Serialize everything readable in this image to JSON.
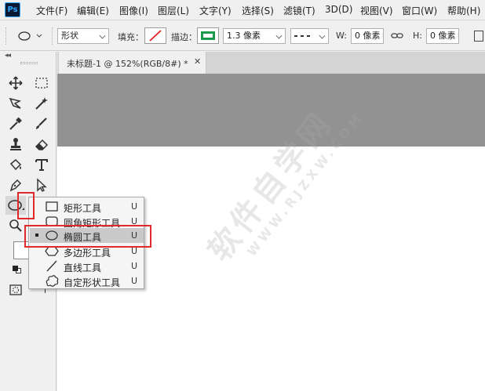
{
  "app": {
    "logo": "Ps"
  },
  "menu": [
    "文件(F)",
    "编辑(E)",
    "图像(I)",
    "图层(L)",
    "文字(Y)",
    "选择(S)",
    "滤镜(T)",
    "3D(D)",
    "视图(V)",
    "窗口(W)",
    "帮助(H)"
  ],
  "options": {
    "mode_value": "形状",
    "fill_label": "填充：",
    "stroke_label": "描边：",
    "stroke_width": "1.3 像素",
    "w_label": "W:",
    "w_value": "0 像素",
    "h_label": "H:",
    "h_value": "0 像素",
    "stroke_color": "#1a9a4a",
    "fill_none_color": "#e02020"
  },
  "document": {
    "tab_title": "未标题-1 @ 152%(RGB/8#) *",
    "close_glyph": "✕"
  },
  "toolbar": {
    "collapse_glyph": "◂◂",
    "tools": [
      "move-tool",
      "marquee-tool",
      "lasso-tool",
      "magic-wand-tool",
      "eyedropper-tool",
      "brush-tool",
      "stamp-tool",
      "eraser-tool",
      "paint-bucket-tool",
      "type-tool",
      "pen-tool",
      "path-selection-tool",
      "ellipse-tool",
      "zoom-tool",
      "color-swatches",
      "quick-mask"
    ]
  },
  "flyout": {
    "items": [
      {
        "label": "矩形工具",
        "key": "U",
        "icon": "rectangle-icon",
        "selected": false
      },
      {
        "label": "圆角矩形工具",
        "key": "U",
        "icon": "rounded-rectangle-icon",
        "selected": false
      },
      {
        "label": "椭圆工具",
        "key": "U",
        "icon": "ellipse-icon",
        "selected": true
      },
      {
        "label": "多边形工具",
        "key": "U",
        "icon": "polygon-icon",
        "selected": false
      },
      {
        "label": "直线工具",
        "key": "U",
        "icon": "line-icon",
        "selected": false
      },
      {
        "label": "自定形状工具",
        "key": "U",
        "icon": "custom-shape-icon",
        "selected": false
      }
    ]
  },
  "watermark": {
    "main": "软件自学网",
    "sub": "WWW.RJZXW.COM"
  },
  "colors": {
    "highlight": "#e22828",
    "canvas_gray": "#929292"
  }
}
